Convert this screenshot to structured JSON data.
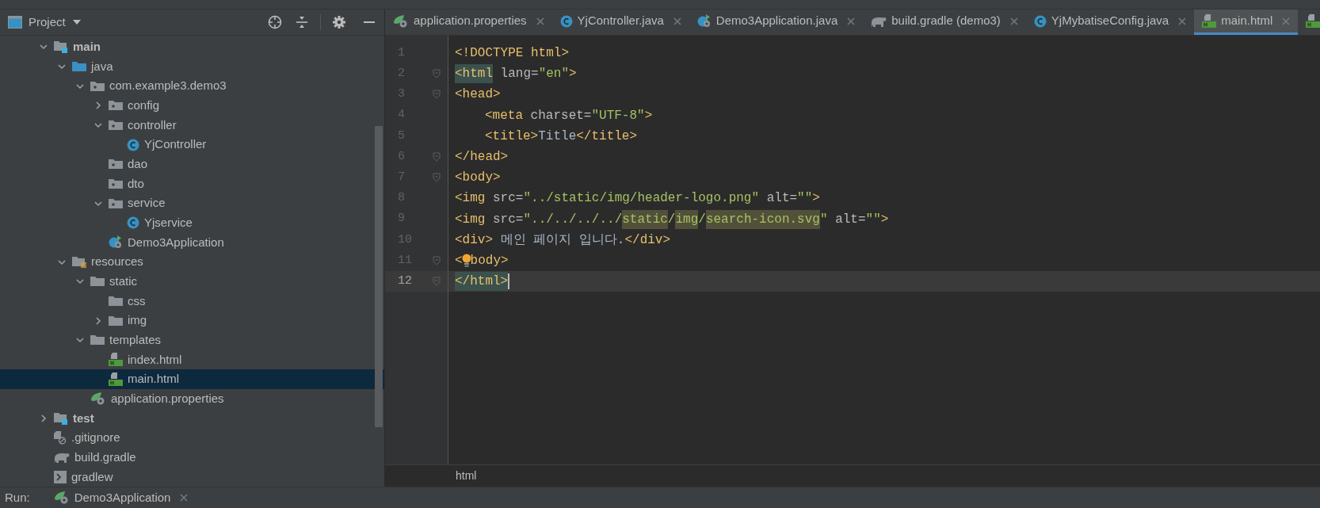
{
  "project_panel": {
    "title": "Project",
    "tree": [
      {
        "label": "main",
        "kind": "module-folder",
        "expanded": true,
        "selected": false,
        "children": [
          {
            "label": "java",
            "kind": "source-folder",
            "expanded": true,
            "selected": false,
            "children": [
              {
                "label": "com.example3.demo3",
                "kind": "package",
                "expanded": true,
                "selected": false,
                "children": [
                  {
                    "label": "config",
                    "kind": "package",
                    "expanded": false,
                    "selected": false
                  },
                  {
                    "label": "controller",
                    "kind": "package",
                    "expanded": true,
                    "selected": false,
                    "children": [
                      {
                        "label": "YjController",
                        "kind": "class",
                        "selected": false
                      }
                    ]
                  },
                  {
                    "label": "dao",
                    "kind": "package",
                    "selected": false
                  },
                  {
                    "label": "dto",
                    "kind": "package",
                    "selected": false
                  },
                  {
                    "label": "service",
                    "kind": "package",
                    "expanded": true,
                    "selected": false,
                    "children": [
                      {
                        "label": "Yjservice",
                        "kind": "class",
                        "selected": false
                      }
                    ]
                  },
                  {
                    "label": "Demo3Application",
                    "kind": "spring-app",
                    "selected": false
                  }
                ]
              }
            ]
          },
          {
            "label": "resources",
            "kind": "resources-folder",
            "expanded": true,
            "selected": false,
            "children": [
              {
                "label": "static",
                "kind": "folder",
                "expanded": true,
                "selected": false,
                "children": [
                  {
                    "label": "css",
                    "kind": "folder",
                    "selected": false
                  },
                  {
                    "label": "img",
                    "kind": "folder",
                    "expanded": false,
                    "selected": false
                  }
                ]
              },
              {
                "label": "templates",
                "kind": "folder",
                "expanded": true,
                "selected": false,
                "children": [
                  {
                    "label": "index.html",
                    "kind": "html",
                    "selected": false
                  },
                  {
                    "label": "main.html",
                    "kind": "html",
                    "selected": true
                  }
                ]
              },
              {
                "label": "application.properties",
                "kind": "properties",
                "selected": false
              }
            ]
          }
        ]
      },
      {
        "label": "test",
        "kind": "module-folder",
        "expanded": false,
        "selected": false
      },
      {
        "label": ".gitignore",
        "kind": "gitignore",
        "selected": false
      },
      {
        "label": "build.gradle",
        "kind": "gradle",
        "selected": false
      },
      {
        "label": "gradlew",
        "kind": "script",
        "selected": false
      }
    ]
  },
  "editor_tabs": [
    {
      "label": "application.properties",
      "kind": "properties",
      "selected": false
    },
    {
      "label": "YjController.java",
      "kind": "class",
      "selected": false
    },
    {
      "label": "Demo3Application.java",
      "kind": "spring-app",
      "selected": false
    },
    {
      "label": "build.gradle (demo3)",
      "kind": "gradle",
      "selected": false
    },
    {
      "label": "YjMybatiseConfig.java",
      "kind": "class",
      "selected": false
    },
    {
      "label": "main.html",
      "kind": "html",
      "selected": true
    },
    {
      "kind": "html",
      "selected": false
    }
  ],
  "code_lines": [
    {
      "number": "1",
      "fold": false,
      "current": false,
      "segments": [
        {
          "kind": "tag",
          "text": "<!DOCTYPE html>"
        }
      ]
    },
    {
      "number": "2",
      "fold": true,
      "current": false,
      "segments": [
        {
          "kind": "tag-match",
          "text": "<html"
        },
        {
          "kind": "attr",
          "text": " lang="
        },
        {
          "kind": "value",
          "text": "\"en\""
        },
        {
          "kind": "tag",
          "text": ">"
        }
      ]
    },
    {
      "number": "3",
      "fold": true,
      "current": false,
      "segments": [
        {
          "kind": "tag",
          "text": "<head>"
        }
      ]
    },
    {
      "number": "4",
      "fold": false,
      "current": false,
      "indented": true,
      "segments": [
        {
          "kind": "tag",
          "text": "<meta"
        },
        {
          "kind": "attr",
          "text": " charset="
        },
        {
          "kind": "value",
          "text": "\"UTF-8\""
        },
        {
          "kind": "tag",
          "text": ">"
        }
      ]
    },
    {
      "number": "5",
      "fold": false,
      "current": false,
      "indented": true,
      "segments": [
        {
          "kind": "tag",
          "text": "<title>"
        },
        {
          "kind": "text",
          "text": "Title"
        },
        {
          "kind": "tag",
          "text": "</title>"
        }
      ]
    },
    {
      "number": "6",
      "fold": true,
      "current": false,
      "segments": [
        {
          "kind": "tag",
          "text": "</head>"
        }
      ]
    },
    {
      "number": "7",
      "fold": true,
      "current": false,
      "segments": [
        {
          "kind": "tag",
          "text": "<body>"
        }
      ]
    },
    {
      "number": "8",
      "fold": false,
      "current": false,
      "segments": [
        {
          "kind": "tag",
          "text": "<img"
        },
        {
          "kind": "attr",
          "text": " src="
        },
        {
          "kind": "value",
          "text": "\"../static/img/header-logo.png\""
        },
        {
          "kind": "attr",
          "text": " alt="
        },
        {
          "kind": "value",
          "text": "\"\""
        },
        {
          "kind": "tag",
          "text": ">"
        }
      ]
    },
    {
      "number": "9",
      "fold": false,
      "current": false,
      "segments": [
        {
          "kind": "tag",
          "text": "<img"
        },
        {
          "kind": "attr",
          "text": " src="
        },
        {
          "kind": "value",
          "text": "\"../../../../"
        },
        {
          "kind": "value-warn",
          "text": "static"
        },
        {
          "kind": "value",
          "text": "/"
        },
        {
          "kind": "value-warn",
          "text": "img"
        },
        {
          "kind": "value",
          "text": "/"
        },
        {
          "kind": "value-warn",
          "text": "search-icon.svg"
        },
        {
          "kind": "value",
          "text": "\""
        },
        {
          "kind": "attr",
          "text": " alt="
        },
        {
          "kind": "value",
          "text": "\"\""
        },
        {
          "kind": "tag",
          "text": ">"
        }
      ]
    },
    {
      "number": "10",
      "fold": false,
      "current": false,
      "segments": [
        {
          "kind": "tag",
          "text": "<div>"
        },
        {
          "kind": "text",
          "text": " 메인 페이지 입니다."
        },
        {
          "kind": "tag",
          "text": "</div>"
        }
      ]
    },
    {
      "number": "11",
      "fold": true,
      "current": false,
      "segments": [
        {
          "kind": "tag",
          "text": "<"
        },
        {
          "kind": "bulb"
        },
        {
          "kind": "tag",
          "text": "body>"
        }
      ]
    },
    {
      "number": "12",
      "fold": true,
      "current": true,
      "segments": [
        {
          "kind": "tag-match",
          "text": "</html>"
        },
        {
          "kind": "caret"
        }
      ]
    }
  ],
  "breadcrumb": "html",
  "run_bar": {
    "label": "Run:",
    "tab": "Demo3Application"
  }
}
